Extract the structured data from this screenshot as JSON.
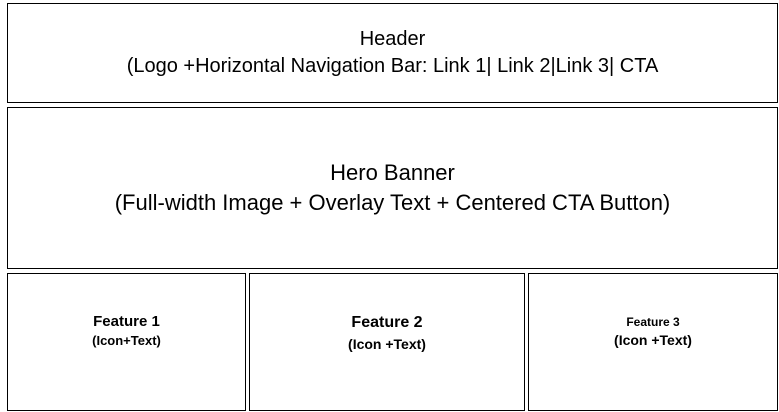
{
  "header": {
    "title": "Header",
    "subtitle": "(Logo +Horizontal Navigation Bar: Link 1| Link 2|Link 3| CTA"
  },
  "hero": {
    "title": "Hero Banner",
    "subtitle": "(Full-width Image + Overlay Text + Centered CTA Button)"
  },
  "features": [
    {
      "title": "Feature 1",
      "subtitle": "(Icon+Text)"
    },
    {
      "title": "Feature 2",
      "subtitle": "(Icon +Text)"
    },
    {
      "title": "Feature 3",
      "subtitle": "(Icon +Text)"
    }
  ],
  "colors": {
    "border": "#000000",
    "background": "#ffffff",
    "text": "#000000"
  }
}
